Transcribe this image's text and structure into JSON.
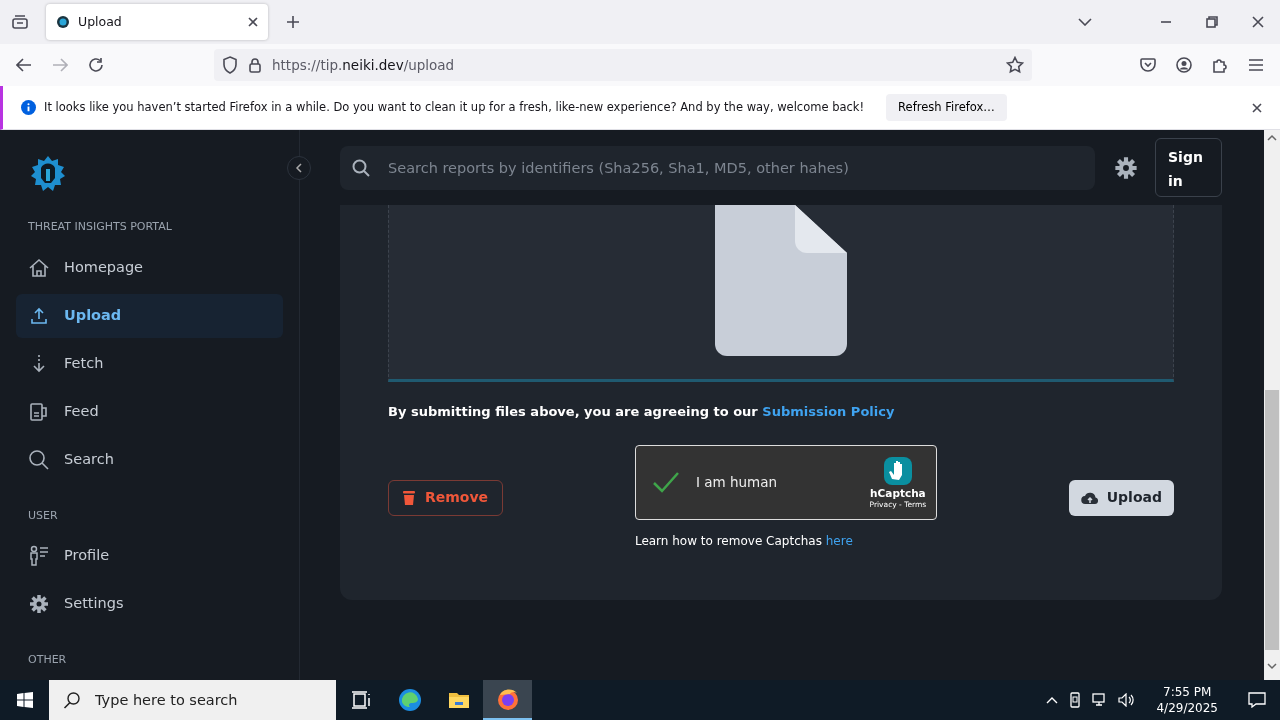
{
  "browser": {
    "tabs": [
      {
        "title": "Upload",
        "selected": true
      }
    ],
    "url": {
      "prefix": "https://tip.",
      "domain": "neiki.dev",
      "path": "/upload"
    },
    "notification": {
      "message": "It looks like you haven’t started Firefox in a while. Do you want to clean it up for a fresh, like-new experience? And by the way, welcome back!",
      "button": "Refresh Firefox…"
    }
  },
  "sidebar": {
    "sections": [
      {
        "label": "THREAT INSIGHTS PORTAL",
        "items": [
          {
            "label": "Homepage",
            "kind": "home",
            "selected": false
          },
          {
            "label": "Upload",
            "kind": "upload",
            "selected": true
          },
          {
            "label": "Fetch",
            "kind": "fetch",
            "selected": false
          },
          {
            "label": "Feed",
            "kind": "feed",
            "selected": false
          },
          {
            "label": "Search",
            "kind": "search",
            "selected": false
          }
        ]
      },
      {
        "label": "USER",
        "items": [
          {
            "label": "Profile",
            "kind": "profile",
            "selected": false
          },
          {
            "label": "Settings",
            "kind": "gear",
            "selected": false
          }
        ]
      },
      {
        "label": "OTHER"
      }
    ]
  },
  "header": {
    "search": {
      "placeholder": "Search reports by identifiers (Sha256, Sha1, MD5, other hahes)"
    },
    "sign_in": "Sign in"
  },
  "upload": {
    "policy_text": "By submitting files above, you are agreeing to our ",
    "policy_link": "Submission Policy",
    "remove_button": "Remove",
    "upload_button": "Upload",
    "captcha": {
      "checked": true,
      "label": "I am human",
      "brand": "hCaptcha",
      "links": "Privacy - Terms"
    },
    "captcha_help": "Learn how to remove Captchas ",
    "captcha_help_link": "here"
  },
  "taskbar": {
    "search": {
      "placeholder": "Type here to search"
    },
    "time": "7:55 PM",
    "date": "4/29/2025"
  }
}
